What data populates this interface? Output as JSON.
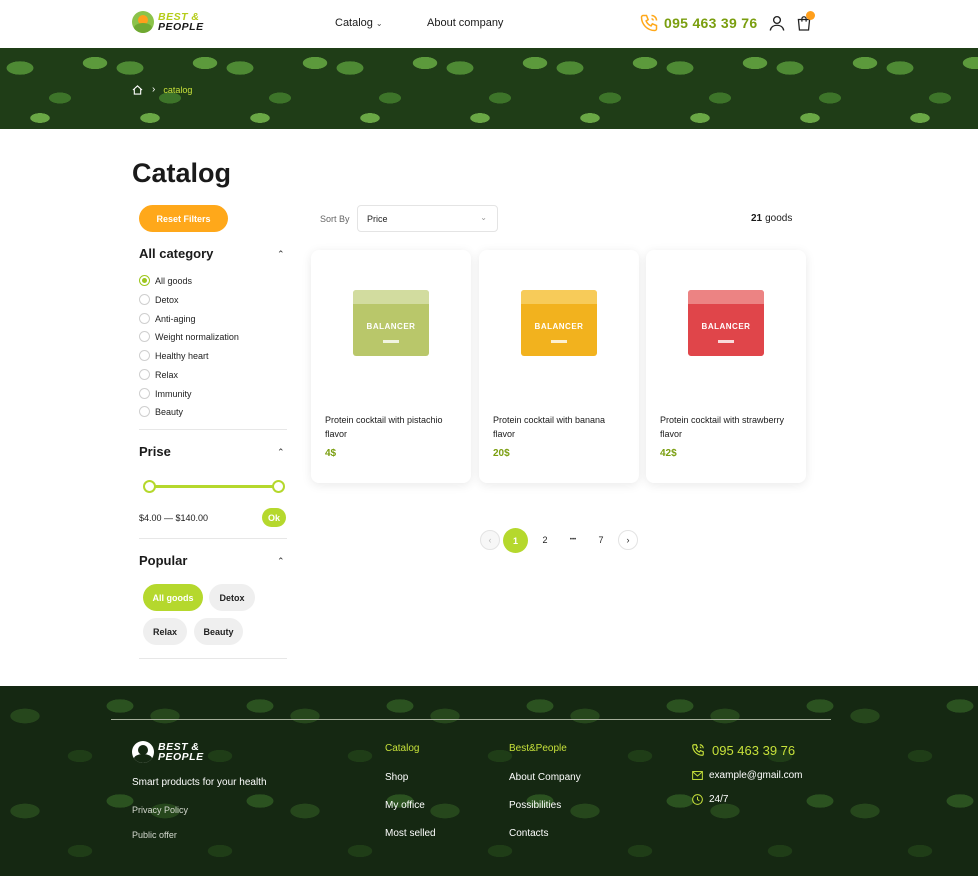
{
  "header": {
    "logo_line1": "BEST &",
    "logo_line2": "PEOPLE",
    "nav_catalog": "Catalog",
    "nav_about": "About company",
    "phone": "095 463 39 76"
  },
  "breadcrumb": {
    "current": "catalog"
  },
  "page_title": "Catalog",
  "filters": {
    "reset_label": "Reset Filters",
    "category_title": "All category",
    "categories": [
      {
        "label": "All goods",
        "selected": true
      },
      {
        "label": "Detox",
        "selected": false
      },
      {
        "label": "Anti-aging",
        "selected": false
      },
      {
        "label": "Weight normalization",
        "selected": false
      },
      {
        "label": "Healthy heart",
        "selected": false
      },
      {
        "label": "Relax",
        "selected": false
      },
      {
        "label": "Immunity",
        "selected": false
      },
      {
        "label": "Beauty",
        "selected": false
      }
    ],
    "price_title": "Prise",
    "price_range": "$4.00 — $140.00",
    "ok_label": "Ok",
    "popular_title": "Popular",
    "chips": [
      {
        "label": "All goods",
        "active": true
      },
      {
        "label": "Detox",
        "active": false
      },
      {
        "label": "Relax",
        "active": false
      },
      {
        "label": "Beauty",
        "active": false
      }
    ]
  },
  "toolbar": {
    "sort_label": "Sort By",
    "sort_value": "Price",
    "goods_count": "21",
    "goods_label": "goods"
  },
  "products": [
    {
      "name": "Protein cocktail with pistachio flavor",
      "price": "4$",
      "box_color": "#b9c76a",
      "box_top": "#e8eccb"
    },
    {
      "name": "Protein cocktail with banana flavor",
      "price": "20$",
      "box_color": "#f2b21e",
      "box_top": "#fbe08a"
    },
    {
      "name": "Protein cocktail with strawberry flavor",
      "price": "42$",
      "box_color": "#e0454a",
      "box_top": "#f6b6b3"
    }
  ],
  "pagination": {
    "prev": "‹",
    "pages": [
      "1",
      "2",
      "•••",
      "7"
    ],
    "current": "1",
    "next": "›"
  },
  "footer": {
    "logo_line1": "BEST &",
    "logo_line2": "PEOPLE",
    "tagline": "Smart products for your health",
    "privacy": "Privacy Policy",
    "offer": "Public offer",
    "col1_title": "Catalog",
    "col1_links": [
      "Shop",
      "My office",
      "Most selled"
    ],
    "col2_title": "Best&People",
    "col2_links": [
      "About Company",
      "Possibilities",
      "Contacts"
    ],
    "phone": "095 463 39 76",
    "email": "example@gmail.com",
    "hours": "24/7"
  },
  "colors": {
    "accent_green": "#b5d82d",
    "accent_orange": "#ffa81a",
    "price_green": "#7a9e0f"
  }
}
